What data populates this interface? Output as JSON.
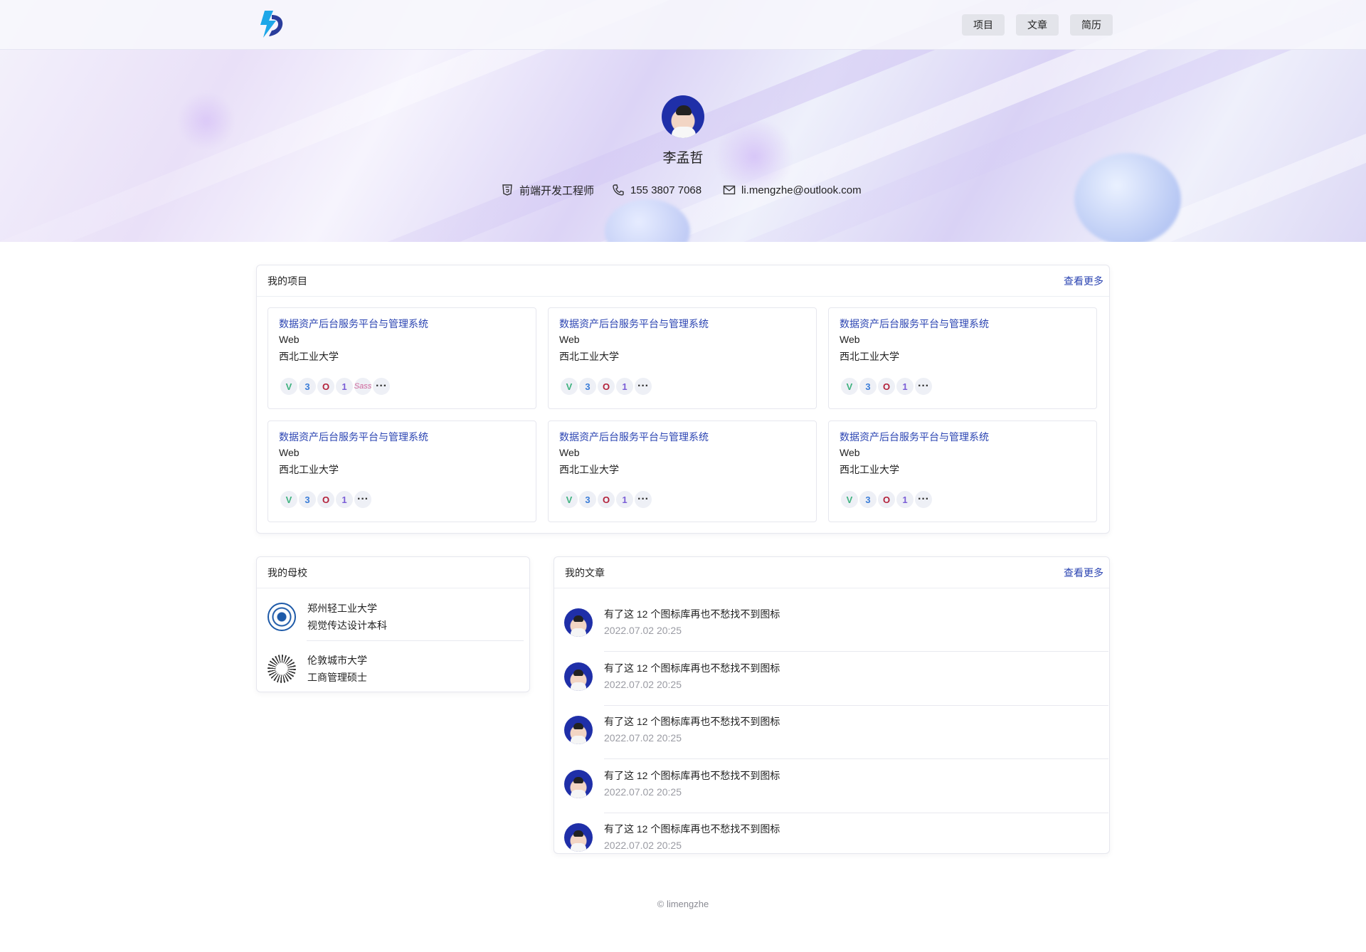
{
  "nav": {
    "items": [
      "项目",
      "文章",
      "简历"
    ]
  },
  "profile": {
    "name": "李孟哲",
    "role": "前端开发工程师",
    "phone": "155 3807 7068",
    "email": "li.mengzhe@outlook.com"
  },
  "projects": {
    "title": "我的项目",
    "more": "查看更多",
    "items": [
      {
        "title": "数据资产后台服务平台与管理系统",
        "type": "Web",
        "org": "西北工业大学",
        "tags": [
          "vue",
          "typescript",
          "opensearch",
          "jit",
          "sass",
          "more"
        ]
      },
      {
        "title": "数据资产后台服务平台与管理系统",
        "type": "Web",
        "org": "西北工业大学",
        "tags": [
          "vue",
          "typescript",
          "opensearch",
          "jit",
          "more"
        ]
      },
      {
        "title": "数据资产后台服务平台与管理系统",
        "type": "Web",
        "org": "西北工业大学",
        "tags": [
          "vue",
          "typescript",
          "opensearch",
          "jit",
          "more"
        ]
      },
      {
        "title": "数据资产后台服务平台与管理系统",
        "type": "Web",
        "org": "西北工业大学",
        "tags": [
          "vue",
          "typescript",
          "opensearch",
          "jit",
          "more"
        ]
      },
      {
        "title": "数据资产后台服务平台与管理系统",
        "type": "Web",
        "org": "西北工业大学",
        "tags": [
          "vue",
          "typescript",
          "opensearch",
          "jit",
          "more"
        ]
      },
      {
        "title": "数据资产后台服务平台与管理系统",
        "type": "Web",
        "org": "西北工业大学",
        "tags": [
          "vue",
          "typescript",
          "opensearch",
          "jit",
          "more"
        ]
      }
    ]
  },
  "schools": {
    "title": "我的母校",
    "items": [
      {
        "name": "郑州轻工业大学",
        "degree": "视觉传达设计本科"
      },
      {
        "name": "伦敦城市大学",
        "degree": "工商管理硕士"
      }
    ]
  },
  "articles": {
    "title": "我的文章",
    "more": "查看更多",
    "items": [
      {
        "title": "有了这 12 个图标库再也不愁找不到图标",
        "date": "2022.07.02 20:25"
      },
      {
        "title": "有了这 12 个图标库再也不愁找不到图标",
        "date": "2022.07.02 20:25"
      },
      {
        "title": "有了这 12 个图标库再也不愁找不到图标",
        "date": "2022.07.02 20:25"
      },
      {
        "title": "有了这 12 个图标库再也不愁找不到图标",
        "date": "2022.07.02 20:25"
      },
      {
        "title": "有了这 12 个图标库再也不愁找不到图标",
        "date": "2022.07.02 20:25"
      }
    ]
  },
  "footer": {
    "text": "© limengzhe"
  },
  "colors": {
    "link": "#2b44b2",
    "avatar_bg": "#1f2fa8",
    "logo": "#1ea7e8"
  }
}
